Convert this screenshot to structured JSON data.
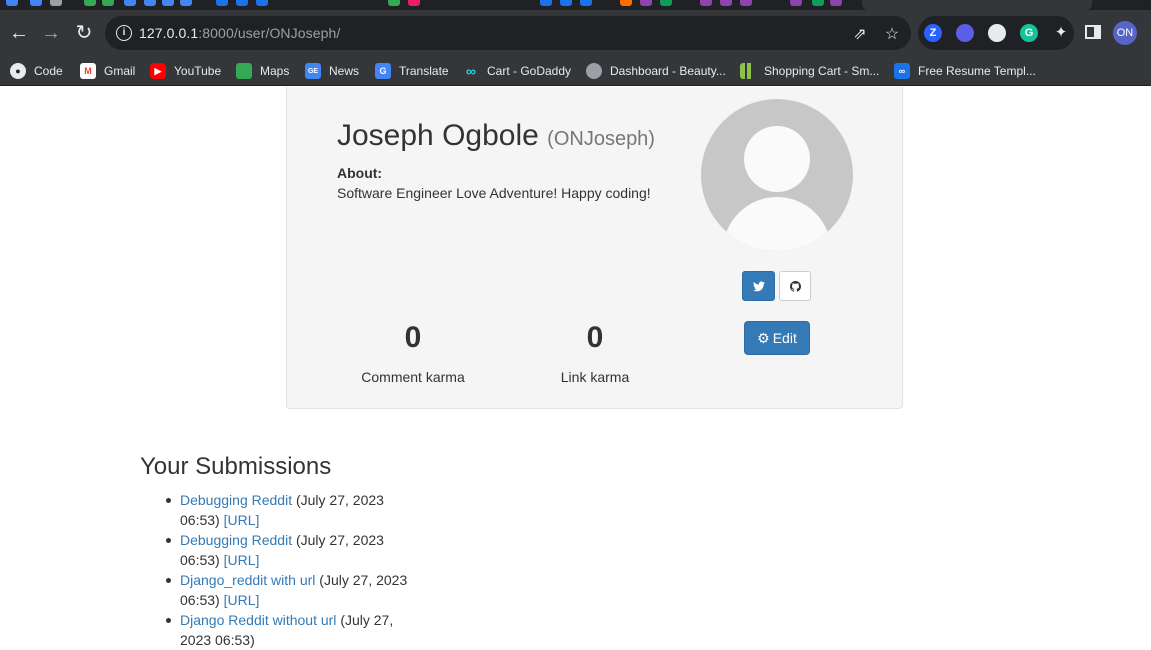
{
  "browser": {
    "url_host": "127.0.0.1",
    "url_path": ":8000/user/ONJoseph/",
    "profile_initials": "ON",
    "bookmarks": [
      {
        "label": "Code",
        "icon": "github-icon"
      },
      {
        "label": "Gmail",
        "icon": "gmail-icon"
      },
      {
        "label": "YouTube",
        "icon": "youtube-icon"
      },
      {
        "label": "Maps",
        "icon": "maps-icon"
      },
      {
        "label": "News",
        "icon": "news-icon"
      },
      {
        "label": "Translate",
        "icon": "translate-icon"
      },
      {
        "label": "Cart - GoDaddy",
        "icon": "godaddy-icon"
      },
      {
        "label": "Dashboard - Beauty...",
        "icon": "globe-icon"
      },
      {
        "label": "Shopping Cart - Sm...",
        "icon": "bars-icon"
      },
      {
        "label": "Free Resume Templ...",
        "icon": "link-icon"
      }
    ]
  },
  "profile": {
    "full_name": "Joseph Ogbole",
    "username": "(ONJoseph)",
    "about_label": "About:",
    "about_text": "Software Engineer Love Adventure! Happy coding!",
    "edit_label": "Edit",
    "comment_karma": "0",
    "comment_karma_label": "Comment karma",
    "link_karma": "0",
    "link_karma_label": "Link karma"
  },
  "submissions": {
    "title": "Your Submissions",
    "items": [
      {
        "title": "Debugging Reddit",
        "date": "(July 27, 2023 06:53)",
        "url_label": "[URL]"
      },
      {
        "title": "Debugging Reddit",
        "date": "(July 27, 2023 06:53)",
        "url_label": "[URL]"
      },
      {
        "title": "Django_reddit with url",
        "date": "(July 27, 2023 06:53)",
        "url_label": "[URL]"
      },
      {
        "title": "Django Reddit without url",
        "date": "(July 27, 2023 06:53)",
        "url_label": ""
      }
    ]
  },
  "colors": {
    "link": "#337ab7",
    "primary_button": "#337ab7",
    "card_background": "#f5f5f5",
    "chrome_dark": "#35363a"
  }
}
